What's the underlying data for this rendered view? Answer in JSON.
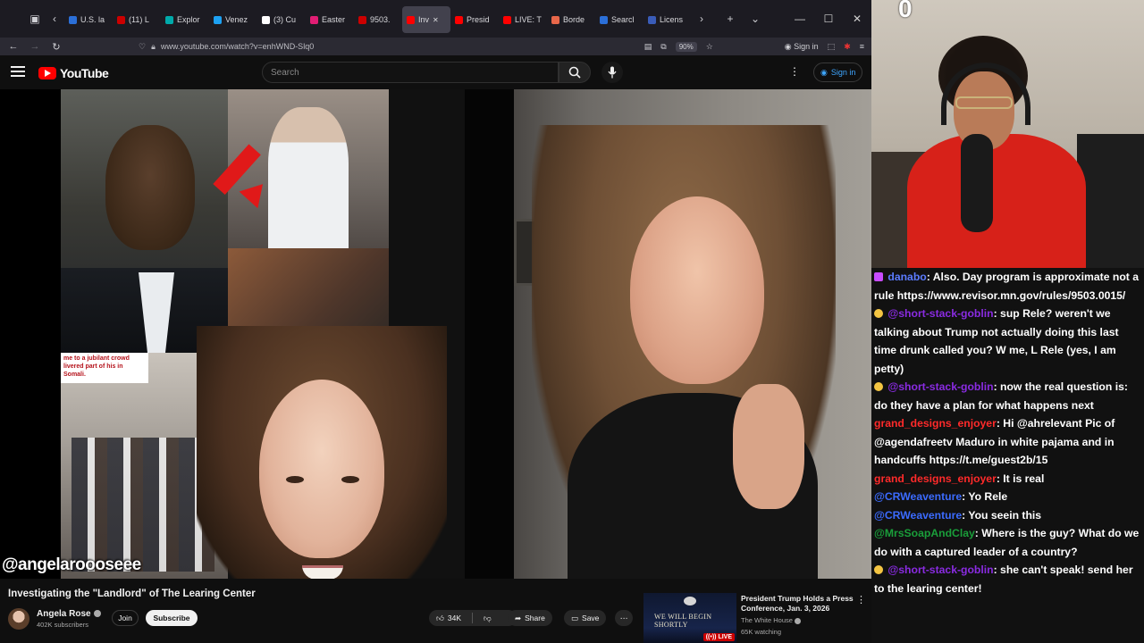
{
  "browser": {
    "tabs": [
      {
        "label": "U.S. la",
        "color": "#2b6fd8"
      },
      {
        "label": "(11) L",
        "color": "#cc0000"
      },
      {
        "label": "Explor",
        "color": "#0aa"
      },
      {
        "label": "Venez",
        "color": "#1da1f2"
      },
      {
        "label": "(3) Cu",
        "color": "#ffffff"
      },
      {
        "label": "Easter",
        "color": "#e11d74"
      },
      {
        "label": "9503.",
        "color": "#cc0000"
      },
      {
        "label": "Inv",
        "color": "#ff0000"
      },
      {
        "label": "Presid",
        "color": "#ff0000"
      },
      {
        "label": "LIVE: T",
        "color": "#ff0000"
      },
      {
        "label": "Borde",
        "color": "#e8674a"
      },
      {
        "label": "Searcl",
        "color": "#2b6fd8"
      },
      {
        "label": "Licens",
        "color": "#3a5cb8"
      }
    ],
    "active_tab": 7,
    "url": "www.youtube.com/watch?v=enhWND-Slq0",
    "zoom": "90%",
    "signin_label": "Sign in"
  },
  "youtube": {
    "logo_text": "YouTube",
    "search_placeholder": "Search",
    "signin_label": "Sign in"
  },
  "video": {
    "watermark": "@angelaroooseee",
    "caption_text": "me to a jubilant crowd livered part of his in Somali."
  },
  "below": {
    "title": "Investigating the \"Landlord\" of The Learing Center",
    "channel": "Angela Rose",
    "subscribers": "402K subscribers",
    "join_label": "Join",
    "subscribe_label": "Subscribe",
    "likes": "34K",
    "share_label": "Share",
    "save_label": "Save"
  },
  "recommendation": {
    "title": "President Trump Holds a Press Conference, Jan. 3, 2026",
    "channel": "The White House",
    "watching": "65K watching",
    "thumb_text": "WE WILL BEGIN SHORTLY",
    "live_label": "LIVE"
  },
  "webcam": {
    "counter": "0"
  },
  "chat": {
    "messages": [
      {
        "user": "danabo",
        "user_color": "#5b7cff",
        "badge_color": "#c84cff",
        "text": ": Also. Day program is approximate not a rule https://www.revisor.mn.gov/rules/9503.0015/"
      },
      {
        "user": "@short-stack-goblin",
        "user_color": "#8a2be2",
        "badge_color": "#f4c542",
        "text": ": sup Rele? weren't we talking about Trump not actually doing this last time drunk called you? W me, L Rele (yes, I am petty)"
      },
      {
        "user": "@short-stack-goblin",
        "user_color": "#8a2be2",
        "badge_color": "#f4c542",
        "text": ": now the real question is: do they have a plan for what happens next"
      },
      {
        "user": "grand_designs_enjoyer",
        "user_color": "#ff2a2a",
        "badge_color": "",
        "text": ": Hi @ahrelevant Pic of @agendafreetv Maduro in white pajama and in handcuffs https://t.me/guest2b/15"
      },
      {
        "user": "grand_designs_enjoyer",
        "user_color": "#ff2a2a",
        "badge_color": "",
        "text": ": It is real"
      },
      {
        "user": "@CRWeaventure",
        "user_color": "#3b6bff",
        "badge_color": "",
        "text": ": Yo Rele"
      },
      {
        "user": "@CRWeaventure",
        "user_color": "#3b6bff",
        "badge_color": "",
        "text": ": You seein this"
      },
      {
        "user": "@MrsSoapAndClay",
        "user_color": "#1a9e3a",
        "badge_color": "",
        "text": ": Where is the guy? What do we do with a captured leader of a country?"
      },
      {
        "user": "@short-stack-goblin",
        "user_color": "#8a2be2",
        "badge_color": "#f4c542",
        "text": ": she can't speak! send her to the learing center!"
      }
    ]
  }
}
